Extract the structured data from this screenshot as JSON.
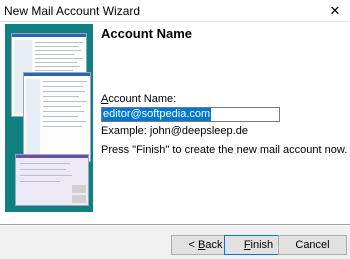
{
  "window": {
    "title": "New Mail Account Wizard",
    "close_glyph": "✕"
  },
  "page": {
    "heading": "Account Name",
    "account_label_prefix": "A",
    "account_label_rest": "ccount Name:",
    "account_value": "editor@softpedia.com",
    "example": "Example: john@deepsleep.de",
    "instruction": "Press \"Finish\" to create the new mail account now."
  },
  "buttons": {
    "back_prefix": "< ",
    "back_mnemonic": "B",
    "back_rest": "ack",
    "finish_mnemonic": "F",
    "finish_rest": "inish",
    "cancel": "Cancel"
  }
}
